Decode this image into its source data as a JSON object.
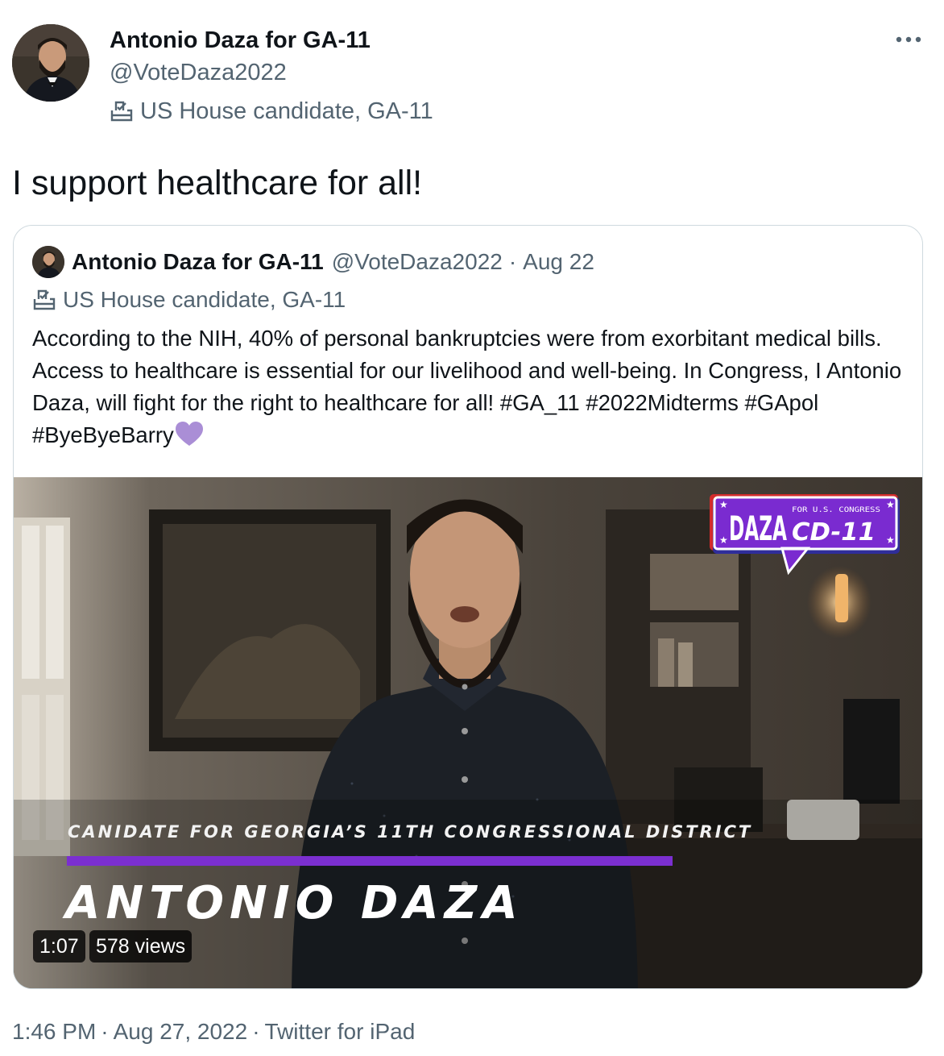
{
  "author": {
    "name": "Antonio Daza for GA-11",
    "handle": "@VoteDaza2022",
    "label": "US House candidate, GA-11",
    "label_icon": "ballot-box-icon"
  },
  "tweet": {
    "text": "I support healthcare for all!"
  },
  "quote": {
    "name": "Antonio Daza for GA-11",
    "handle": "@VoteDaza2022",
    "separator": "·",
    "date": "Aug 22",
    "label": "US House candidate, GA-11",
    "text": "According to the NIH, 40% of personal bankruptcies were from exorbitant medical bills. Access to healthcare is essential for our livelihood and well-being. In Congress, I Antonio Daza, will fight for the right to healthcare for all! #GA_11 #2022Midterms #GApol #ByeByeBarry",
    "emoji": "purple-heart-icon",
    "video": {
      "subtitle": "CANIDATE FOR GEORGIA’S 11TH CONGRESSIONAL DISTRICT",
      "name": "ANTONIO DAZA",
      "duration": "1:07",
      "views": "578 views",
      "logo": {
        "word": "DAZA",
        "small": "FOR U.S. CONGRESS",
        "district": "CD-11"
      }
    }
  },
  "footer": {
    "time": "1:46 PM",
    "date": "Aug 27, 2022",
    "source": "Twitter for iPad",
    "separator": "·"
  },
  "colors": {
    "accent_purple": "#7b2fd0",
    "muted_text": "#536471",
    "border": "#cfd9de"
  }
}
